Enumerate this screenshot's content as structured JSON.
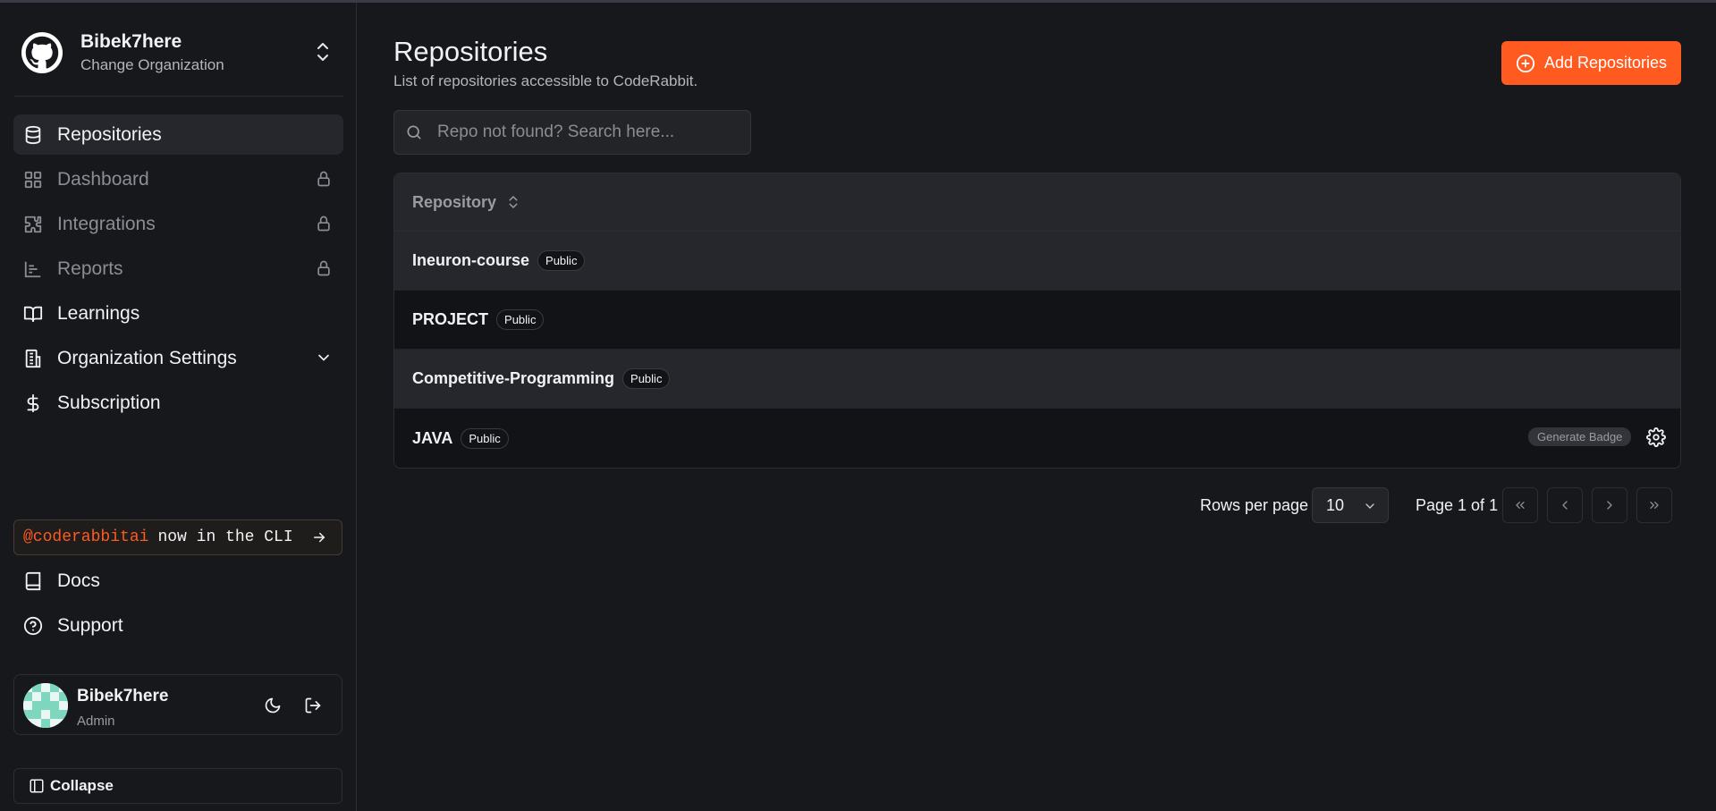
{
  "org": {
    "name": "Bibek7here",
    "subtitle": "Change Organization"
  },
  "sidebar": {
    "items": [
      {
        "label": "Repositories",
        "icon": "database-icon",
        "state": "active"
      },
      {
        "label": "Dashboard",
        "icon": "grid-icon",
        "state": "locked"
      },
      {
        "label": "Integrations",
        "icon": "puzzle-icon",
        "state": "locked"
      },
      {
        "label": "Reports",
        "icon": "chart-icon",
        "state": "locked"
      },
      {
        "label": "Learnings",
        "icon": "book-open-icon",
        "state": "normal"
      },
      {
        "label": "Organization Settings",
        "icon": "building-icon",
        "state": "expandable"
      },
      {
        "label": "Subscription",
        "icon": "dollar-icon",
        "state": "normal"
      }
    ],
    "cli_banner": {
      "handle": "@coderabbitai",
      "text": "now in the CLI"
    },
    "bottom_items": [
      {
        "label": "Docs",
        "icon": "book-icon"
      },
      {
        "label": "Support",
        "icon": "help-circle-icon"
      }
    ],
    "user": {
      "name": "Bibek7here",
      "role": "Admin"
    },
    "collapse_label": "Collapse"
  },
  "main": {
    "title": "Repositories",
    "subtitle": "List of repositories accessible to CodeRabbit.",
    "add_button_label": "Add Repositories",
    "search_placeholder": "Repo not found? Search here...",
    "table": {
      "header": "Repository",
      "rows": [
        {
          "name": "Ineuron-course",
          "visibility": "Public"
        },
        {
          "name": "PROJECT",
          "visibility": "Public"
        },
        {
          "name": "Competitive-Programming",
          "visibility": "Public"
        },
        {
          "name": "JAVA",
          "visibility": "Public",
          "action": "Generate Badge"
        }
      ]
    },
    "pagination": {
      "rows_per_page_label": "Rows per page",
      "rows_per_page_value": "10",
      "page_info": "Page 1 of 1"
    }
  },
  "colors": {
    "accent": "#ff5a1f",
    "background": "#17181c",
    "row_alt": "#26272c"
  }
}
